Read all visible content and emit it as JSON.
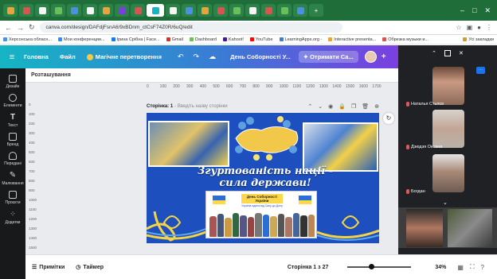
{
  "browser": {
    "url": "canva.com/design/DAFdjFsnA6/9xBDnm_ctCsF74Z0R/6uQ/edit",
    "bookmarks": [
      "Херсонська обласн...",
      "Мои конференции...",
      "Ірина Срібна | Face...",
      "Gmail",
      "Dashboard",
      "Kahoot!",
      "YouTube",
      "LearningApps.org -",
      "Interactive presenta...",
      "Обрезка музыки и..."
    ],
    "bookmarks_folder": "Усі закладки"
  },
  "canva": {
    "menu_home": "Головна",
    "menu_file": "Файл",
    "magic": "Магічне перетворення",
    "doc_title": "День Соборності У...",
    "upgrade": "Отримати Са...",
    "rail": [
      "Дизайн",
      "Елементи",
      "Текст",
      "Бренд",
      "Передані",
      "Малювання",
      "Проєкти",
      "Додатки"
    ],
    "panel_title": "Розташування",
    "ruler": [
      "0",
      "100",
      "200",
      "300",
      "400",
      "500",
      "600",
      "700",
      "800",
      "900",
      "1000",
      "1100",
      "1200",
      "1300",
      "1400",
      "1500",
      "1600",
      "1700",
      "1800"
    ],
    "vruler": [
      "0",
      "100",
      "200",
      "300",
      "400",
      "500",
      "600",
      "700",
      "800",
      "900",
      "1000",
      "1100",
      "1200",
      "1300",
      "1400",
      "1500",
      "1600",
      "1700",
      "1800"
    ],
    "page_label": "Сторінка: 1",
    "page_placeholder": "- Введіть назву сторінки",
    "slide": {
      "slogan_line1": "Згуртованість нації -",
      "slogan_line2": "сила держави!",
      "poster_title": "День Соборності України",
      "poster_sub": "Україна єдина від Сяну до Дону"
    },
    "notes": "Примітки",
    "timer": "Таймер",
    "page_count": "Сторінка 1 з 27",
    "zoom_percent": 34,
    "zoom": "34%"
  },
  "meet": {
    "participants": [
      {
        "name": "Наталья Стьпєв"
      },
      {
        "name": "Дзюдзя Оксана"
      },
      {
        "name": "Богдан"
      }
    ]
  },
  "colors": {
    "slide_blue": "#1d4fbf",
    "yellow": "#ffd84a",
    "tab_green": "#1f6e3a"
  }
}
